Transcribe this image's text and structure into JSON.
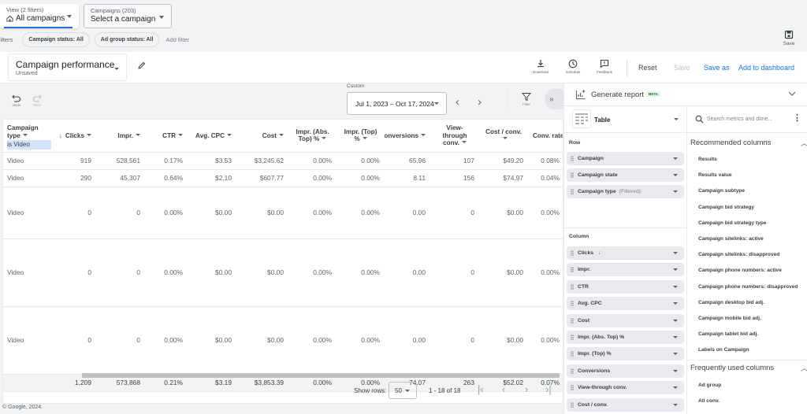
{
  "top": {
    "view_label": "View (2 filters)",
    "view_value": "All campaigns",
    "campaigns_label": "Campaigns (203)",
    "campaigns_value": "Select a campaign",
    "filters_label": "Filters",
    "filter_chips": [
      "Campaign status: All",
      "Ad group status: All"
    ],
    "add_filter": "Add filter",
    "save_label": "Save"
  },
  "report": {
    "name": "Campaign performance",
    "status": "Unsaved",
    "toolbar": {
      "download": "Download",
      "schedule": "Schedule",
      "feedback": "Feedback",
      "reset": "Reset",
      "save": "Save",
      "save_as": "Save as",
      "add_to_dashboard": "Add to dashboard"
    },
    "undo": "Undo",
    "redo": "Redo",
    "date_label": "Custom",
    "date_range": "Jul 1, 2023 – Oct 17, 2024",
    "filter_label": "Filter",
    "expand_label": "»"
  },
  "table": {
    "columns": [
      "Campaign type",
      "Clicks",
      "Impr.",
      "CTR",
      "Avg. CPC",
      "Cost",
      "Impr. (Abs. Top) %",
      "Impr. (Top) %",
      "Conversions",
      "View-through conv.",
      "Cost / conv.",
      "Conv. rate"
    ],
    "first_col_filter": "is Video",
    "rows": [
      [
        "Video",
        "919",
        "528,561",
        "0.17%",
        "$3.53",
        "$3,245.62",
        "0.00%",
        "0.00%",
        "65.96",
        "107",
        "$49.20",
        "0.08%"
      ],
      [
        "Video",
        "290",
        "45,307",
        "0.64%",
        "$2.10",
        "$607.77",
        "0.00%",
        "0.00%",
        "8.11",
        "156",
        "$74.97",
        "0.04%"
      ],
      [
        "Video",
        "0",
        "0",
        "0.00%",
        "$0.00",
        "$0.00",
        "0.00%",
        "0.00%",
        "0.00",
        "0",
        "$0.00",
        "0.00%"
      ],
      [
        "Video",
        "0",
        "0",
        "0.00%",
        "$0.00",
        "$0.00",
        "0.00%",
        "0.00%",
        "0.00",
        "0",
        "$0.00",
        "0.00%"
      ],
      [
        "Video",
        "0",
        "0",
        "0.00%",
        "$0.00",
        "$0.00",
        "0.00%",
        "0.00%",
        "0.00",
        "0",
        "$0.00",
        "0.00%"
      ]
    ],
    "totals": [
      "",
      "1,209",
      "573,868",
      "0.21%",
      "$3.19",
      "$3,853.39",
      "0.00%",
      "0.00%",
      "74.07",
      "263",
      "$52.02",
      "0.07%"
    ],
    "show_rows_label": "Show rows:",
    "show_rows_value": "50",
    "range_text": "1 - 18 of 18"
  },
  "copyright": "© Google, 2024.",
  "panel": {
    "generate_report": "Generate report",
    "beta": "BETA",
    "viz_type": "Table",
    "row_label": "Row",
    "row_items": [
      {
        "label": "Campaign",
        "note": ""
      },
      {
        "label": "Campaign state",
        "note": ""
      },
      {
        "label": "Campaign type",
        "note": "(Filtered)"
      }
    ],
    "column_label": "Column",
    "column_items": [
      "Clicks",
      "Impr.",
      "CTR",
      "Avg. CPC",
      "Cost",
      "Impr. (Abs. Top) %",
      "Impr. (Top) %",
      "Conversions",
      "View-through conv.",
      "Cost / conv."
    ],
    "search_placeholder": "Search metrics and dime...",
    "recommended_header": "Recommended columns",
    "recommended": [
      "Results",
      "Results value",
      "Campaign subtype",
      "Campaign bid strategy",
      "Campaign bid strategy type",
      "Campaign sitelinks: active",
      "Campaign sitelinks: disapproved",
      "Campaign phone numbers: active",
      "Campaign phone numbers: disapproved",
      "Campaign desktop bid adj.",
      "Campaign mobile bid adj.",
      "Campaign tablet bid adj.",
      "Labels on Campaign"
    ],
    "frequent_header": "Frequently used columns",
    "frequent": [
      "Ad group",
      "All conv."
    ]
  },
  "colors": {
    "accent": "#1a73e8",
    "beta_bg": "#e6f4ea",
    "beta_fg": "#137333",
    "filter_highlight": "#d2e3fc"
  }
}
